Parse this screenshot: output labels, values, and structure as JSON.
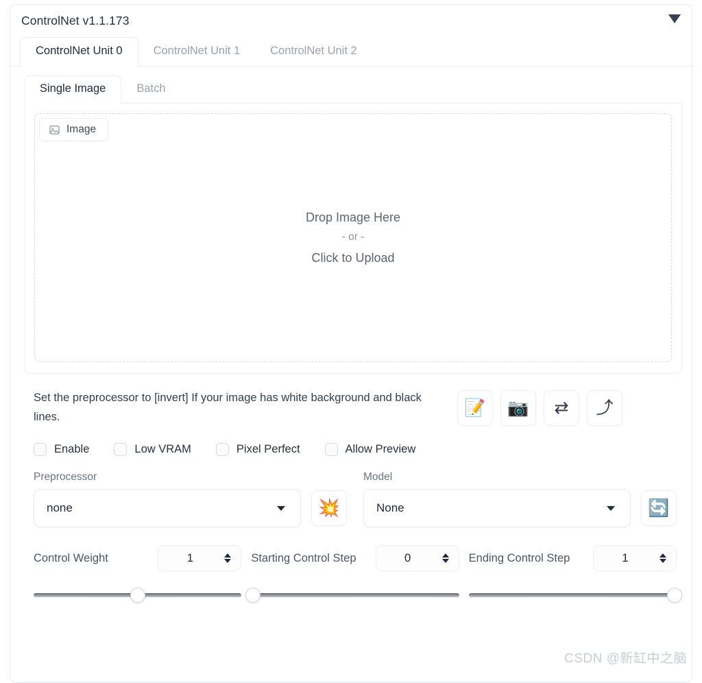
{
  "panel": {
    "title": "ControlNet v1.1.173",
    "collapse_icon": "caret-down-icon"
  },
  "unit_tabs": [
    {
      "label": "ControlNet Unit 0",
      "active": true
    },
    {
      "label": "ControlNet Unit 1",
      "active": false
    },
    {
      "label": "ControlNet Unit 2",
      "active": false
    }
  ],
  "source_tabs": [
    {
      "label": "Single Image",
      "active": true
    },
    {
      "label": "Batch",
      "active": false
    }
  ],
  "upload": {
    "chip_label": "Image",
    "chip_icon": "image-icon",
    "drop_primary": "Drop Image Here",
    "drop_or": "- or -",
    "drop_secondary": "Click to Upload"
  },
  "hint": {
    "text": "Set the preprocessor to [invert] If your image has white background and black lines."
  },
  "tool_buttons": [
    {
      "name": "open-new-canvas-button",
      "icon": "memo-pencil-icon",
      "glyph": "📝"
    },
    {
      "name": "webcam-button",
      "icon": "camera-icon",
      "glyph": "📷"
    },
    {
      "name": "mirror-webcam-button",
      "icon": "swap-arrows-icon",
      "glyph": "⇄"
    },
    {
      "name": "send-dimensions-button",
      "icon": "arrow-up-icon",
      "glyph": "⤴"
    }
  ],
  "checkboxes": [
    {
      "label": "Enable",
      "checked": false
    },
    {
      "label": "Low VRAM",
      "checked": false
    },
    {
      "label": "Pixel Perfect",
      "checked": false
    },
    {
      "label": "Allow Preview",
      "checked": false
    }
  ],
  "preprocessor": {
    "label": "Preprocessor",
    "value": "none",
    "run_button": {
      "icon": "explosion-icon",
      "glyph": "💥"
    }
  },
  "model": {
    "label": "Model",
    "value": "None",
    "refresh_button": {
      "icon": "refresh-icon",
      "glyph": "🔄"
    }
  },
  "sliders": [
    {
      "label": "Control Weight",
      "value": "1",
      "percent": 50
    },
    {
      "label": "Starting Control Step",
      "value": "0",
      "percent": 0
    },
    {
      "label": "Ending Control Step",
      "value": "1",
      "percent": 100
    }
  ],
  "watermark": "CSDN @新缸中之脑",
  "colors": {
    "text_primary": "#27303f",
    "text_muted": "#9aa1ae",
    "border": "#e7e9ee",
    "background": "#ffffff"
  }
}
